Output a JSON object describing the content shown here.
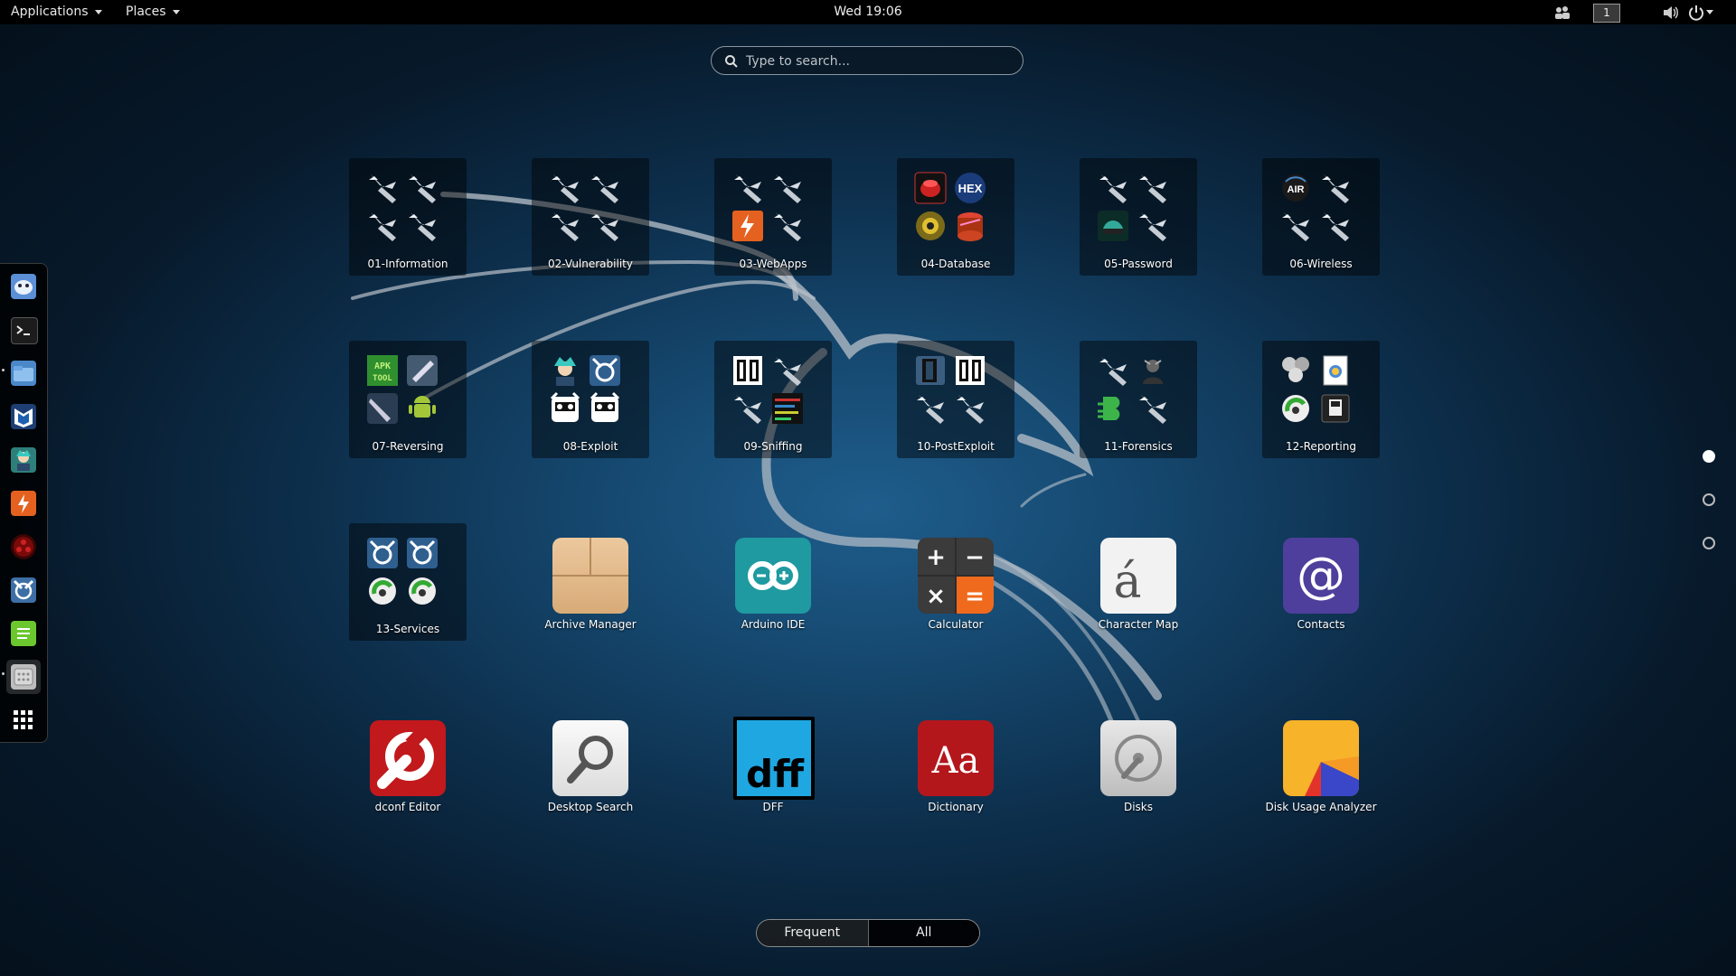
{
  "topbar": {
    "applications": "Applications",
    "places": "Places",
    "clock": "Wed 19:06",
    "workspace": "1"
  },
  "search": {
    "placeholder": "Type to search..."
  },
  "dash": [
    {
      "name": "beef-xss",
      "color": "#5b8fd6"
    },
    {
      "name": "terminal",
      "color": "#1c1c1c"
    },
    {
      "name": "files",
      "color": "#4b88c9"
    },
    {
      "name": "metasploit",
      "color": "#2a5fa8"
    },
    {
      "name": "armitage",
      "color": "#2e7f7a"
    },
    {
      "name": "burpsuite",
      "color": "#e4611f"
    },
    {
      "name": "faraday",
      "color": "#6a0d0d"
    },
    {
      "name": "maltego",
      "color": "#3d6fa6"
    },
    {
      "name": "leafpad",
      "color": "#6bc72d"
    },
    {
      "name": "screenshot",
      "color": "#bdbdbd"
    },
    {
      "name": "show-apps",
      "color": "#000000"
    }
  ],
  "folders": [
    {
      "label": "01-Information"
    },
    {
      "label": "02-Vulnerability"
    },
    {
      "label": "03-WebApps"
    },
    {
      "label": "04-Database"
    },
    {
      "label": "05-Password"
    },
    {
      "label": "06-Wireless"
    },
    {
      "label": "07-Reversing"
    },
    {
      "label": "08-Exploit"
    },
    {
      "label": "09-Sniffing"
    },
    {
      "label": "10-PostExploit"
    },
    {
      "label": "11-Forensics"
    },
    {
      "label": "12-Reporting"
    },
    {
      "label": "13-Services"
    }
  ],
  "apps": [
    {
      "label": "Archive Manager",
      "icon": "archive-icon"
    },
    {
      "label": "Arduino IDE",
      "icon": "arduino-icon"
    },
    {
      "label": "Calculator",
      "icon": "calculator-icon"
    },
    {
      "label": "Character Map",
      "icon": "character-map-icon"
    },
    {
      "label": "Contacts",
      "icon": "contacts-icon"
    },
    {
      "label": "dconf Editor",
      "icon": "dconf-icon"
    },
    {
      "label": "Desktop Search",
      "icon": "desktop-search-icon"
    },
    {
      "label": "DFF",
      "icon": "dff-icon"
    },
    {
      "label": "Dictionary",
      "icon": "dictionary-icon"
    },
    {
      "label": "Disks",
      "icon": "disks-icon"
    },
    {
      "label": "Disk Usage Analyzer",
      "icon": "disk-usage-icon"
    }
  ],
  "icon_text": {
    "hex": "HEX",
    "air": "AIR",
    "apk": "APK\nTOOL",
    "char": "á",
    "at": "@",
    "aa": "Aa",
    "dff": "dff",
    "plus": "+",
    "minus": "−",
    "times": "×",
    "eq": "="
  },
  "switcher": {
    "frequent": "Frequent",
    "all": "All"
  },
  "pages": {
    "count": 3,
    "active": 1
  }
}
